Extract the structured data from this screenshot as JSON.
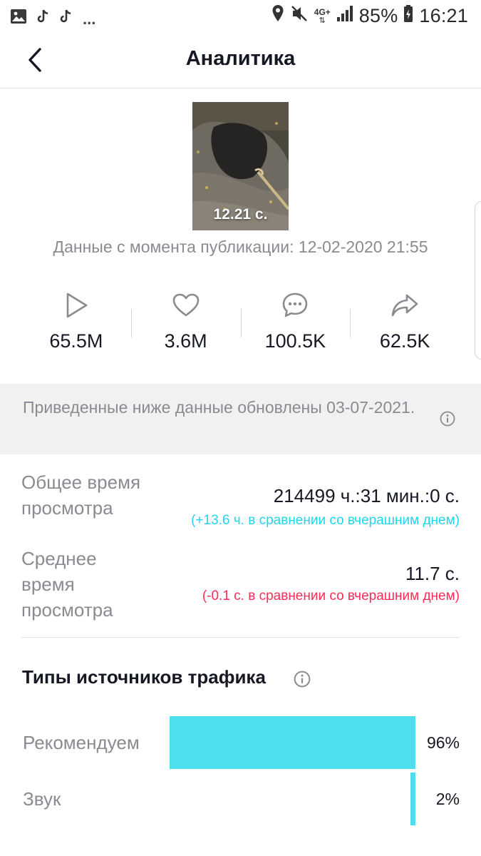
{
  "status_bar": {
    "left_icons": [
      "image-icon",
      "tiktok-icon",
      "tiktok-icon"
    ],
    "more": "...",
    "network": "4G+",
    "battery_percent": "85%",
    "time": "16:21"
  },
  "header": {
    "title": "Аналитика",
    "back_icon": "chevron-left-icon"
  },
  "video": {
    "duration": "12.21 с.",
    "published_text": "Данные с момента публикации: 12-02-2020 21:55"
  },
  "stats": [
    {
      "icon": "play-icon",
      "value": "65.5M"
    },
    {
      "icon": "heart-icon",
      "value": "3.6M"
    },
    {
      "icon": "comment-icon",
      "value": "100.5K"
    },
    {
      "icon": "share-icon",
      "value": "62.5K"
    }
  ],
  "banner": {
    "text": "Приведенные ниже данные обновлены 03-07-2021.",
    "icon": "info-icon"
  },
  "metrics": {
    "total_watch": {
      "label": "Общее время просмотра",
      "value": "214499 ч.:31 мин.:0 с.",
      "delta": "(+13.6 ч. в сравнении со вчерашним днем)"
    },
    "avg_watch": {
      "label": "Среднее время просмотра",
      "value": "11.7 с.",
      "delta": "(-0.1 с. в сравнении со вчерашним днем)"
    }
  },
  "traffic": {
    "title": "Типы источников трафика",
    "info_icon": "info-icon",
    "sources": [
      {
        "label": "Рекомендуем",
        "percent_text": "96%",
        "percent": 96
      },
      {
        "label": "Звук",
        "percent_text": "2%",
        "percent": 2
      }
    ]
  },
  "colors": {
    "accent_cyan": "#4ddfee",
    "delta_positive": "#20d5ec",
    "delta_negative": "#fe2c55",
    "muted_text": "#8a8b91",
    "banner_bg": "#f1f1f2"
  }
}
